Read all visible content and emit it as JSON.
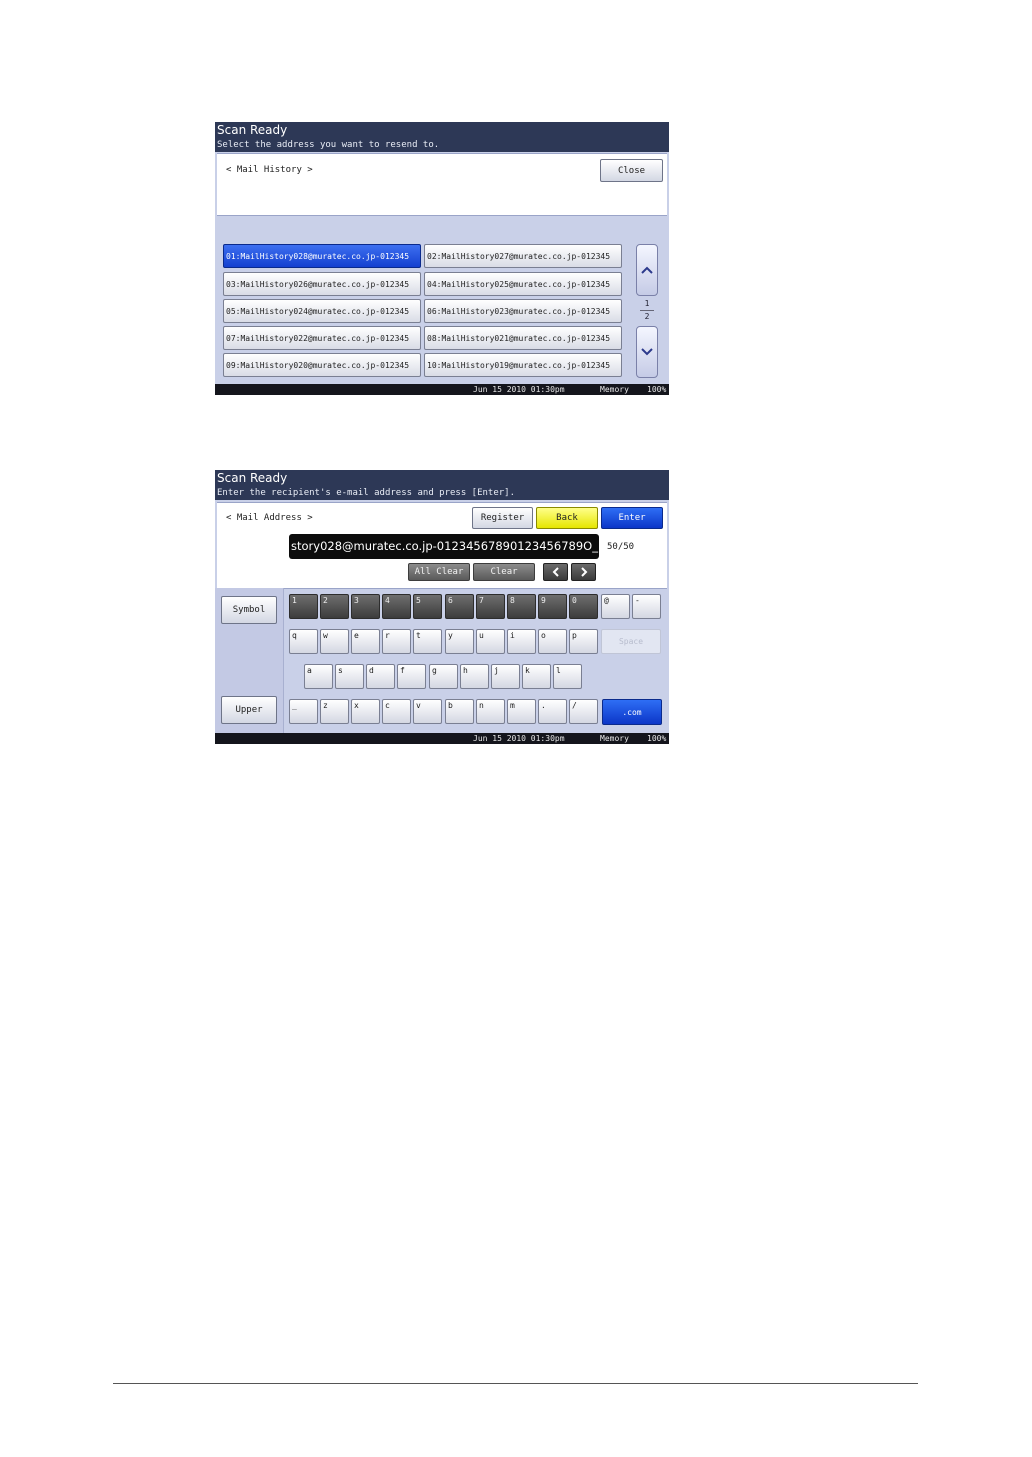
{
  "screen1": {
    "title": "Scan Ready",
    "subtitle": "Select the address you want to resend to.",
    "breadcrumb": "< Mail History >",
    "close_label": "Close",
    "history": [
      "01:MailHistory028@muratec.co.jp-012345",
      "02:MailHistory027@muratec.co.jp-012345",
      "03:MailHistory026@muratec.co.jp-012345",
      "04:MailHistory025@muratec.co.jp-012345",
      "05:MailHistory024@muratec.co.jp-012345",
      "06:MailHistory023@muratec.co.jp-012345",
      "07:MailHistory022@muratec.co.jp-012345",
      "08:MailHistory021@muratec.co.jp-012345",
      "09:MailHistory020@muratec.co.jp-012345",
      "10:MailHistory019@muratec.co.jp-012345"
    ],
    "selected_index": 0,
    "page_current": "1",
    "page_total": "2",
    "status": {
      "datetime": "Jun 15 2010 01:30pm",
      "memory_label": "Memory",
      "memory_value": "100%"
    }
  },
  "screen2": {
    "title": "Scan Ready",
    "subtitle": "Enter the recipient's e-mail address and press [Enter].",
    "breadcrumb": "< Mail Address >",
    "register_label": "Register",
    "back_label": "Back",
    "enter_label": "Enter",
    "input_value": "story028@muratec.co.jp-01234567890123456789O_",
    "counter": "50/50",
    "all_clear_label": "All Clear",
    "clear_label": "Clear",
    "symbol_label": "Symbol",
    "upper_label": "Upper",
    "space_label": "Space",
    "com_label": ".com",
    "keys_row1": [
      "1",
      "2",
      "3",
      "4",
      "5",
      "6",
      "7",
      "8",
      "9",
      "0",
      "@",
      "-"
    ],
    "keys_row2": [
      "q",
      "w",
      "e",
      "r",
      "t",
      "y",
      "u",
      "i",
      "o",
      "p"
    ],
    "keys_row3": [
      "a",
      "s",
      "d",
      "f",
      "g",
      "h",
      "j",
      "k",
      "l"
    ],
    "keys_row4": [
      "_",
      "z",
      "x",
      "c",
      "v",
      "b",
      "n",
      "m",
      ".",
      "/"
    ],
    "status": {
      "datetime": "Jun 15 2010 01:30pm",
      "memory_label": "Memory",
      "memory_value": "100%"
    }
  },
  "icons": {
    "up": "chevron-up-icon",
    "down": "chevron-down-icon",
    "left": "chevron-left-icon",
    "right": "chevron-right-icon"
  },
  "colors": {
    "header": "#2d3856",
    "selected": "#1f52dc",
    "back": "#f0f000",
    "enter": "#1745d8",
    "screen_bg": "#c9d0e8"
  }
}
